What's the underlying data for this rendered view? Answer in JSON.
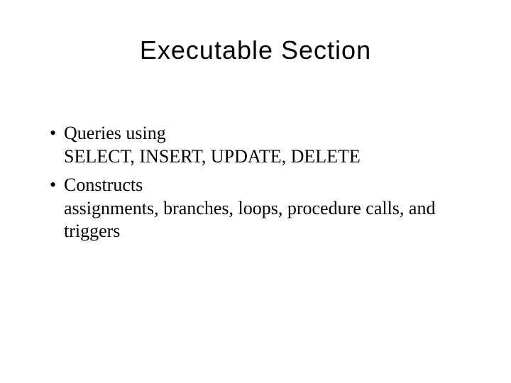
{
  "title": "Executable Section",
  "bullets": [
    {
      "line1": "Queries using",
      "line2": "SELECT, INSERT, UPDATE, DELETE"
    },
    {
      "line1": "Constructs",
      "line2": "assignments, branches, loops, procedure calls, and triggers"
    }
  ]
}
